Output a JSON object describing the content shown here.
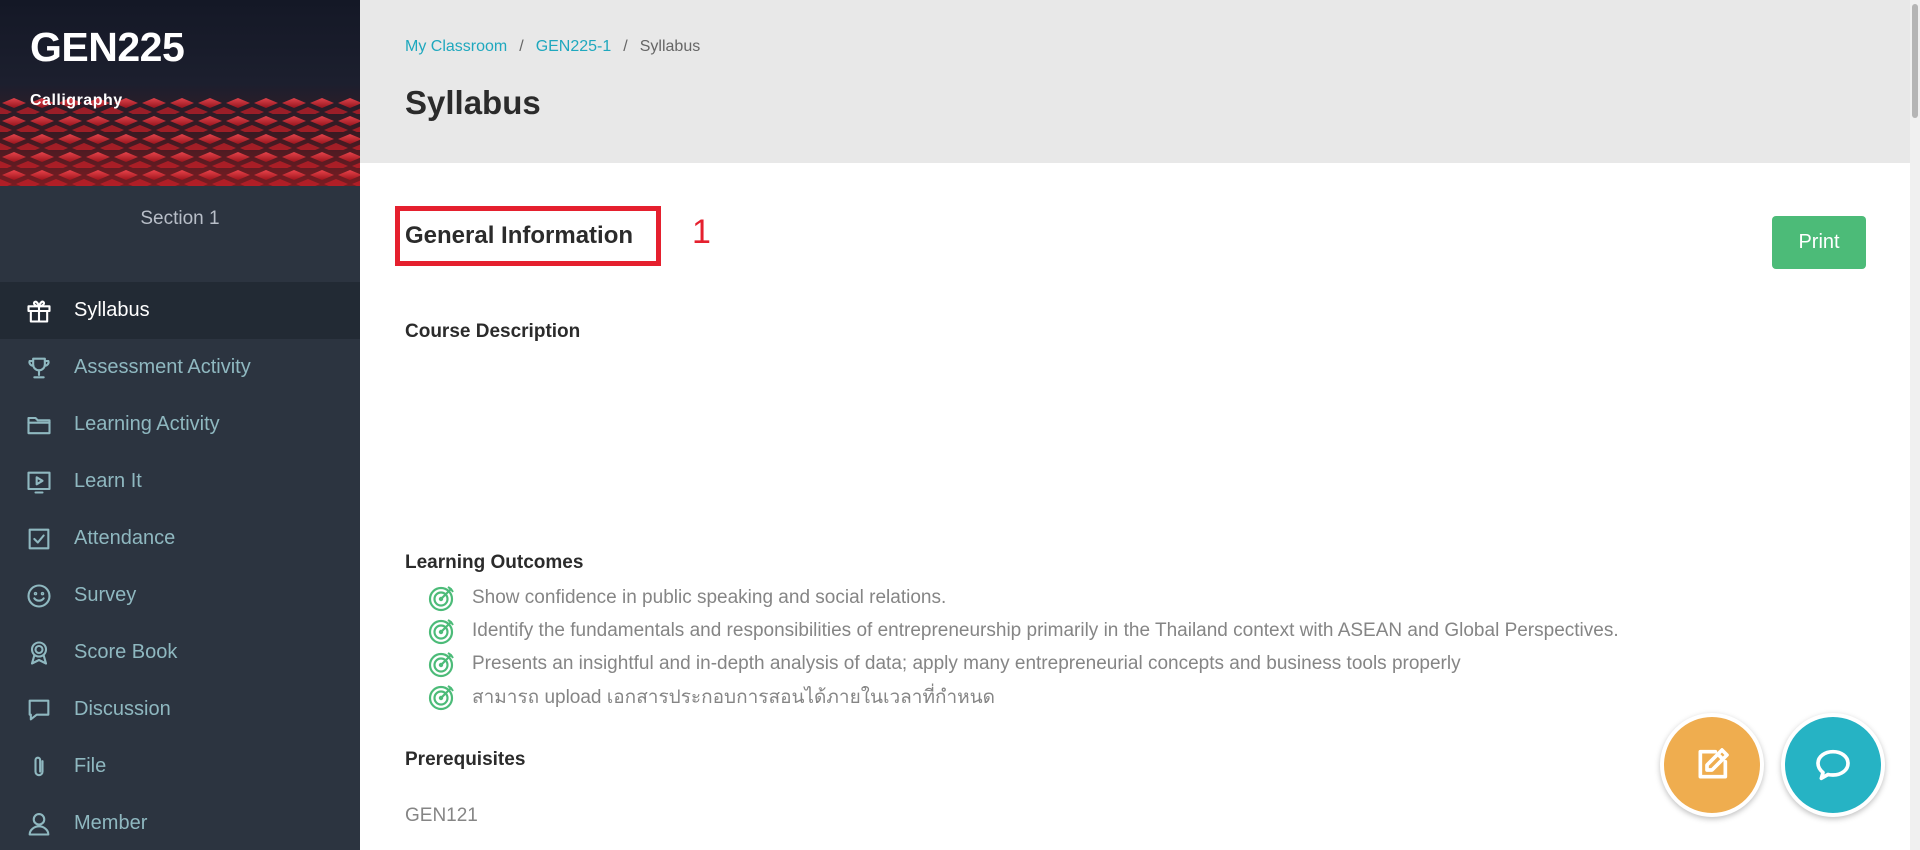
{
  "sidebar": {
    "course_code": "GEN225",
    "course_name": "Calligraphy",
    "section": "Section 1",
    "items": [
      {
        "label": "Syllabus",
        "icon": "gift-icon",
        "active": true
      },
      {
        "label": "Assessment Activity",
        "icon": "trophy-icon",
        "active": false
      },
      {
        "label": "Learning Activity",
        "icon": "folder-icon",
        "active": false
      },
      {
        "label": "Learn It",
        "icon": "video-icon",
        "active": false
      },
      {
        "label": "Attendance",
        "icon": "checkbox-icon",
        "active": false
      },
      {
        "label": "Survey",
        "icon": "smiley-icon",
        "active": false
      },
      {
        "label": "Score Book",
        "icon": "award-icon",
        "active": false
      },
      {
        "label": "Discussion",
        "icon": "chat-bubble-icon",
        "active": false
      },
      {
        "label": "File",
        "icon": "paperclip-icon",
        "active": false
      },
      {
        "label": "Member",
        "icon": "user-icon",
        "active": false
      }
    ]
  },
  "header": {
    "breadcrumb": [
      "My Classroom",
      "GEN225-1",
      "Syllabus"
    ],
    "title": "Syllabus"
  },
  "main": {
    "general_info_title": "General Information",
    "annotation_number": "1",
    "print_label": "Print",
    "course_description_heading": "Course Description",
    "learning_outcomes_heading": "Learning Outcomes",
    "learning_outcomes": [
      "Show confidence in public speaking and social relations.",
      "Identify the fundamentals and responsibilities of entrepreneurship primarily in the Thailand context with ASEAN and Global Perspectives.",
      "Presents an insightful and in-depth analysis of data; apply many entrepreneurial concepts and business tools properly",
      "สามารถ upload เอกสารประกอบการสอนได้ภายในเวลาที่กำหนด"
    ],
    "prerequisites_heading": "Prerequisites",
    "prerequisites_value": "GEN121"
  },
  "colors": {
    "sidebar_bg": "#2c3440",
    "accent_link": "#1fa8be",
    "print_button": "#4cbb78",
    "annotation_red": "#e5202e",
    "fab_edit": "#efad4f",
    "fab_chat": "#26b3c4"
  }
}
